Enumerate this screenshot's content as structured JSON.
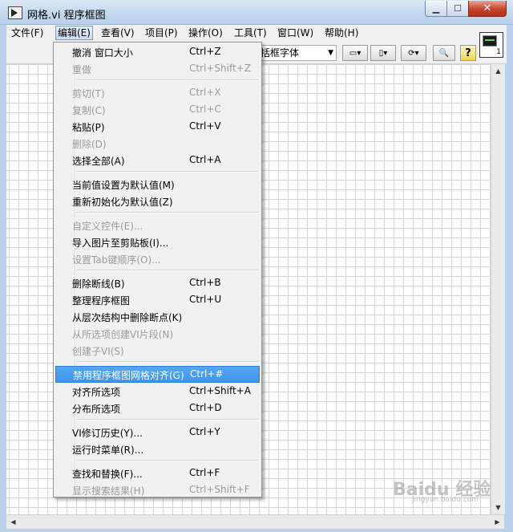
{
  "window": {
    "title": "网格.vi 程序框图"
  },
  "menubar": {
    "items": [
      "文件(F)",
      "编辑(E)",
      "查看(V)",
      "项目(P)",
      "操作(O)",
      "工具(T)",
      "窗口(W)",
      "帮助(H)"
    ],
    "active": "编辑(E)"
  },
  "toolbar": {
    "font_select": "括框字体",
    "vi_icon_number": "1"
  },
  "edit_menu": {
    "items": [
      {
        "label": "撤消 窗口大小",
        "shortcut": "Ctrl+Z",
        "enabled": true
      },
      {
        "label": "重做",
        "shortcut": "Ctrl+Shift+Z",
        "enabled": false
      },
      {
        "label": "剪切(T)",
        "shortcut": "Ctrl+X",
        "enabled": false
      },
      {
        "label": "复制(C)",
        "shortcut": "Ctrl+C",
        "enabled": false
      },
      {
        "label": "粘贴(P)",
        "shortcut": "Ctrl+V",
        "enabled": true
      },
      {
        "label": "删除(D)",
        "shortcut": "",
        "enabled": false
      },
      {
        "label": "选择全部(A)",
        "shortcut": "Ctrl+A",
        "enabled": true
      },
      {
        "label": "当前值设置为默认值(M)",
        "shortcut": "",
        "enabled": true
      },
      {
        "label": "重新初始化为默认值(Z)",
        "shortcut": "",
        "enabled": true
      },
      {
        "label": "自定义控件(E)...",
        "shortcut": "",
        "enabled": false
      },
      {
        "label": "导入图片至剪贴板(I)...",
        "shortcut": "",
        "enabled": true
      },
      {
        "label": "设置Tab键顺序(O)...",
        "shortcut": "",
        "enabled": false
      },
      {
        "label": "删除断线(B)",
        "shortcut": "Ctrl+B",
        "enabled": true
      },
      {
        "label": "整理程序框图",
        "shortcut": "Ctrl+U",
        "enabled": true
      },
      {
        "label": "从层次结构中删除断点(K)",
        "shortcut": "",
        "enabled": true
      },
      {
        "label": "从所选项创建VI片段(N)",
        "shortcut": "",
        "enabled": false
      },
      {
        "label": "创建子VI(S)",
        "shortcut": "",
        "enabled": false
      },
      {
        "label": "禁用程序框图网格对齐(G)",
        "shortcut": "Ctrl+#",
        "enabled": true,
        "highlighted": true
      },
      {
        "label": "对齐所选项",
        "shortcut": "Ctrl+Shift+A",
        "enabled": true
      },
      {
        "label": "分布所选项",
        "shortcut": "Ctrl+D",
        "enabled": true
      },
      {
        "label": "VI修订历史(Y)...",
        "shortcut": "Ctrl+Y",
        "enabled": true
      },
      {
        "label": "运行时菜单(R)...",
        "shortcut": "",
        "enabled": true
      },
      {
        "label": "查找和替换(F)...",
        "shortcut": "Ctrl+F",
        "enabled": true
      },
      {
        "label": "显示搜索结果(H)",
        "shortcut": "Ctrl+Shift+F",
        "enabled": false
      }
    ]
  },
  "watermark": {
    "text": "Baidu 经验",
    "sub": "jingyan.baidu.com"
  },
  "colors": {
    "highlight": "#3f95eb",
    "disabled": "#9a9a9a",
    "grid": "#d6d6d6"
  }
}
